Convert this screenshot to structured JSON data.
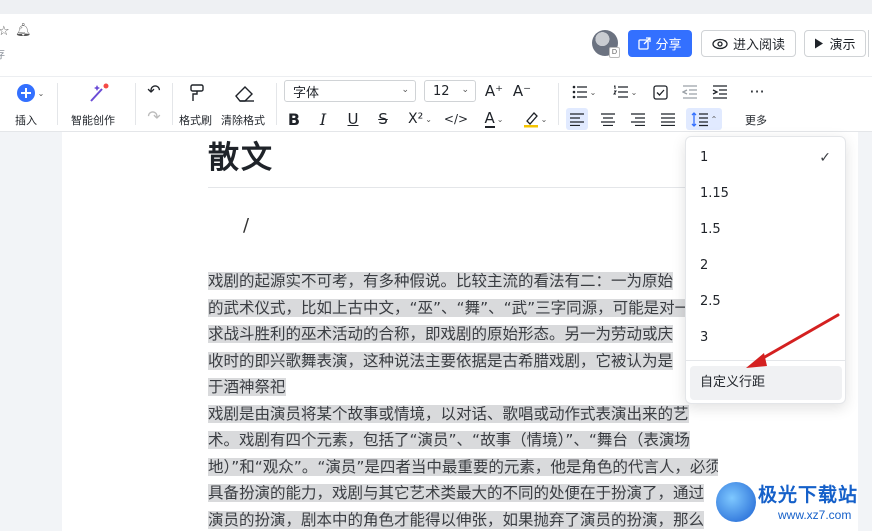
{
  "header": {
    "saved_text": "存",
    "share_label": "分享",
    "read_mode_label": "进入阅读",
    "present_label": "演示",
    "avatar_badge": "D"
  },
  "toolbar": {
    "insert_label": "插入",
    "ai_label": "智能创作",
    "format_painter_label": "格式刷",
    "clear_format_label": "清除格式",
    "font_value": "字体",
    "font_size_value": "12",
    "more_label": "更多",
    "grow_font": "A⁺",
    "shrink_font": "A⁻",
    "bold": "B",
    "italic": "I",
    "underline": "U",
    "strike": "S",
    "superscript": "X²",
    "code": "</>",
    "font_color": "A",
    "highlight": "🖍"
  },
  "document": {
    "title": "散文",
    "placeholder": "/",
    "lines": [
      "戏剧的起源实不可考，有多种假说。比较主流的看法有二：一为原始",
      "的武术仪式，比如上古中文，“巫”、“舞”、“武”三字同源，可能是对一",
      "求战斗胜利的巫术活动的合称，即戏剧的原始形态。另一为劳动或庆",
      "收时的即兴歌舞表演，这种说法主要依据是古希腊戏剧，它被认为是",
      "于酒神祭祀",
      "戏剧是由演员将某个故事或情境，以对话、歌唱或动作式表演出来的艺",
      "术。戏剧有四个元素，包括了“演员”、“故事（情境）”、“舞台（表演场",
      "地）”和“观众”。“演员”是四者当中最重要的元素，他是角色的代言人，必须",
      "具备扮演的能力，戏剧与其它艺术类最大的不同的处便在于扮演了，通过",
      "演员的扮演，剧本中的角色才能得以伸张，如果抛弃了演员的扮演，那么"
    ]
  },
  "line_spacing_menu": {
    "options": [
      "1",
      "1.15",
      "1.5",
      "2",
      "2.5",
      "3"
    ],
    "selected": "1",
    "custom_label": "自定义行距"
  },
  "watermark": {
    "brand": "极光下载站",
    "url": "www.xz7.com"
  },
  "colors": {
    "accent": "#3370ff",
    "selection": "#d9dadc",
    "arrow": "#d42020"
  }
}
